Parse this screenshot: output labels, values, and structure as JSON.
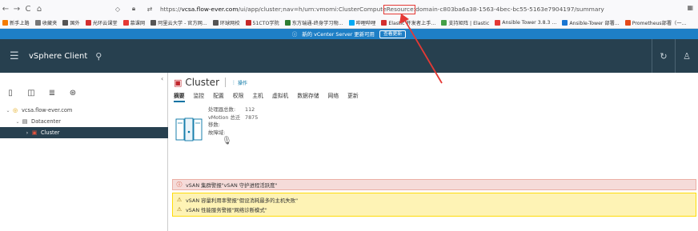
{
  "browser": {
    "url_scheme": "https://",
    "url_host": "vcsa.flow-ever.com",
    "url_path": "/ui/app/cluster;nav=h/urn:vmomi:ClusterComputeResource:domain-c803ba6a38-1563-4bec-bc55-5163e7904197/summary",
    "bookmarks": [
      {
        "label": "新手上路",
        "color": "#f57c00"
      },
      {
        "label": "收藏夹",
        "color": "#777777"
      },
      {
        "label": "国外",
        "color": "#555555"
      },
      {
        "label": "光环云课堂",
        "color": "#d32f2f"
      },
      {
        "label": "慕课网",
        "color": "#e53935"
      },
      {
        "label": "阿里云大学 - 官方网...",
        "color": "#555555"
      },
      {
        "label": "环球网校",
        "color": "#555555"
      },
      {
        "label": "51CTO学院",
        "color": "#c62828"
      },
      {
        "label": "东方瑞通-终身学习物...",
        "color": "#2e7d32"
      },
      {
        "label": "哔哩哔哩",
        "color": "#03a9f4"
      },
      {
        "label": "Elastic 开发者上手...",
        "color": "#d32f2f"
      },
      {
        "label": "支持矩阵 | Elastic",
        "color": "#43a047"
      },
      {
        "label": "Ansible Tower 3.8.3 ...",
        "color": "#e53935"
      },
      {
        "label": "Ansible-Tower 部署...",
        "color": "#1976d2"
      },
      {
        "label": "Prometheus部署（一...",
        "color": "#e64a19"
      }
    ]
  },
  "banner": {
    "text": "新的 vCenter Server 更新可用",
    "button": "查看更新"
  },
  "header": {
    "title": "vSphere Client"
  },
  "sidebar": {
    "tree": [
      {
        "label": "vcsa.flow-ever.com",
        "chev": "⌄",
        "icon": "◎",
        "indent": 0
      },
      {
        "label": "Datacenter",
        "chev": "⌄",
        "icon": "▤",
        "indent": 1
      },
      {
        "label": "Cluster",
        "chev": "›",
        "icon": "▣",
        "indent": 2
      }
    ]
  },
  "main": {
    "title": "Cluster",
    "actions_label": "操作",
    "tabs": [
      "摘要",
      "监控",
      "配置",
      "权限",
      "主机",
      "虚拟机",
      "数据存储",
      "网络",
      "更新"
    ],
    "summary": {
      "rows": [
        {
          "label": "处理器总数:",
          "value": "112"
        },
        {
          "label": "vMotion 总迁移数:",
          "value": "7875"
        },
        {
          "label": "故障域:",
          "value": ""
        }
      ]
    },
    "alerts": {
      "red": "vSAN 集群警报\"vSAN 守护进程活跃度\"",
      "yellow": [
        "vSAN 容量利用率警报\"假设消耗最多的主机失败\"",
        "vSAN 性能服务警报\"网络诊断模式\""
      ]
    }
  },
  "colors": {
    "header_bg": "#27404f",
    "banner_bg": "#1e7fc6",
    "accent": "#0072a3",
    "annotation_red": "#e53935"
  }
}
